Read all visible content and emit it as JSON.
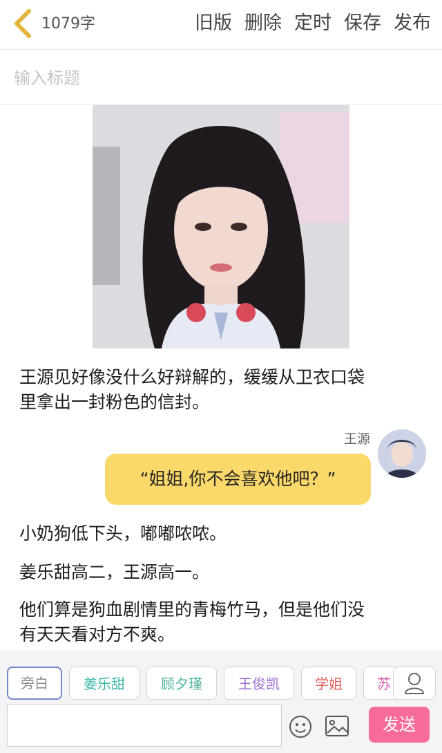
{
  "header": {
    "word_count": "1079字",
    "actions": [
      "旧版",
      "删除",
      "定时",
      "保存",
      "发布"
    ]
  },
  "title_input": {
    "placeholder": "输入标题",
    "value": ""
  },
  "content": {
    "paragraph_1_line_1": "王源见好像没什么好辩解的，缓缓从卫衣口袋",
    "paragraph_1_line_2": "里拿出一封粉色的信封。",
    "speaker": "王源",
    "bubble_text": "“姐姐,你不会喜欢他吧？”",
    "paragraph_2": "小奶狗低下头，嘟嘟哝哝。",
    "paragraph_3": "姜乐甜高二，王源高一。",
    "paragraph_4_line_1": "他们算是狗血剧情里的青梅竹马，但是他们没",
    "paragraph_4_line_2": "有天天看对方不爽。"
  },
  "role_chips": [
    {
      "label": "旁白",
      "color": "#8a8a8a"
    },
    {
      "label": "姜乐甜",
      "color": "#3bb8a8"
    },
    {
      "label": "顾夕瑾",
      "color": "#4cb39a"
    },
    {
      "label": "王俊凯",
      "color": "#9b6fd0"
    },
    {
      "label": "学姐",
      "color": "#e25a5a"
    },
    {
      "label": "苏",
      "color": "#d65ab0"
    }
  ],
  "composer": {
    "input_value": "",
    "send_label": "发送"
  },
  "colors": {
    "bubble": "#fbd86a",
    "send": "#f86c9b",
    "back_arrow": "#e3b53c"
  }
}
